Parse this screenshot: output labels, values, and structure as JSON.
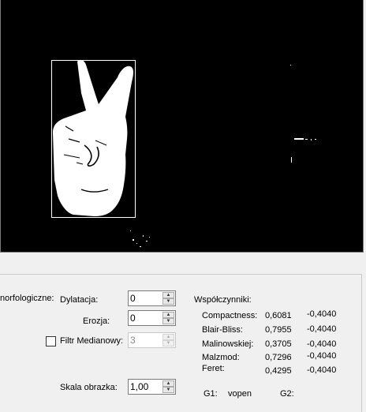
{
  "morph": {
    "section_label": "norfologiczne:",
    "dilation_label": "Dylatacja:",
    "dilation_value": "0",
    "erosion_label": "Erozja:",
    "erosion_value": "0",
    "median_label": "Filtr Medianowy:",
    "median_value": "3",
    "median_checked": false,
    "scale_label": "Skala obrazka:",
    "scale_value": "1,00"
  },
  "coefficients": {
    "title": "Współczynniki:",
    "rows": [
      {
        "name": "Compactness:",
        "value": "0,6081",
        "value2": "-0,4040"
      },
      {
        "name": "Blair-Bliss:",
        "value": "0,7955",
        "value2": "-0,4040"
      },
      {
        "name": "Malinowskiej:",
        "value": "0,3705",
        "value2": "-0,4040"
      },
      {
        "name": "Malzmod:",
        "value": "0,7296",
        "value2": "-0,4040"
      },
      {
        "name": "Feret:",
        "value": "0,4295",
        "value2": "-0,4040"
      }
    ]
  },
  "gestures": {
    "g1_label": "G1:",
    "g1_value": "vopen",
    "g2_label": "G2:"
  },
  "icons": {
    "spin_up": "triangle-up-icon",
    "spin_down": "triangle-down-icon"
  },
  "colors": {
    "image_background": "#000000",
    "bounding_box": "#ffffff",
    "panel_background": "#f0f0f0"
  }
}
